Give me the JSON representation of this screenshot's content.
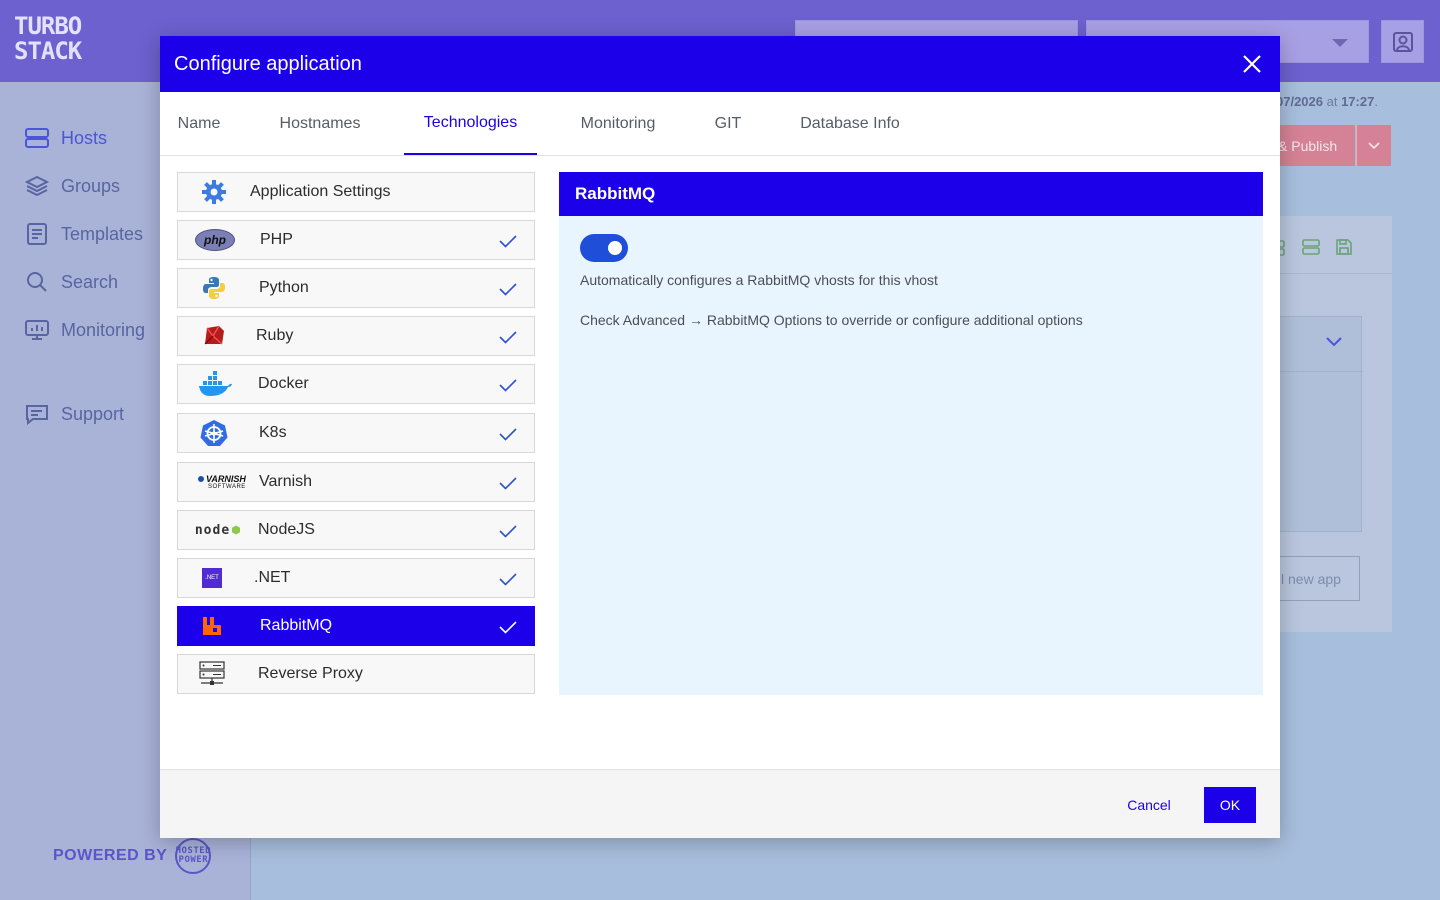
{
  "app": {
    "logo_text": "TURBO STACK",
    "powered_by": "POWERED BY",
    "powered_logo_text": "HOSTED POWER"
  },
  "sidebar": {
    "items": [
      {
        "label": "Hosts",
        "icon": "hosts-icon",
        "active": true
      },
      {
        "label": "Groups",
        "icon": "groups-icon"
      },
      {
        "label": "Templates",
        "icon": "templates-icon"
      },
      {
        "label": "Search",
        "icon": "search-icon"
      },
      {
        "label": "Monitoring",
        "icon": "monitoring-icon"
      },
      {
        "label": "Support",
        "icon": "support-icon"
      }
    ]
  },
  "background": {
    "date_text": "07/2026",
    "date_at": " at ",
    "time_text": "17:27",
    "date_end": ".",
    "publish_label": "& Publish",
    "new_app_label": "l new app"
  },
  "modal": {
    "title": "Configure application",
    "tabs": [
      {
        "label": "Name"
      },
      {
        "label": "Hostnames"
      },
      {
        "label": "Technologies",
        "active": true
      },
      {
        "label": "Monitoring"
      },
      {
        "label": "GIT"
      },
      {
        "label": "Database Info"
      }
    ],
    "technologies": [
      {
        "label": "Application Settings",
        "icon": "gear-icon",
        "checked": false
      },
      {
        "label": "PHP",
        "icon": "php-icon",
        "checked": true
      },
      {
        "label": "Python",
        "icon": "python-icon",
        "checked": true
      },
      {
        "label": "Ruby",
        "icon": "ruby-icon",
        "checked": true
      },
      {
        "label": "Docker",
        "icon": "docker-icon",
        "checked": true
      },
      {
        "label": "K8s",
        "icon": "kubernetes-icon",
        "checked": true
      },
      {
        "label": "Varnish",
        "icon": "varnish-icon",
        "checked": true
      },
      {
        "label": "NodeJS",
        "icon": "nodejs-icon",
        "checked": true
      },
      {
        "label": ".NET",
        "icon": "dotnet-icon",
        "checked": true
      },
      {
        "label": "RabbitMQ",
        "icon": "rabbitmq-icon",
        "checked": true,
        "active": true
      },
      {
        "label": "Reverse Proxy",
        "icon": "server-icon",
        "checked": false
      }
    ],
    "icon_texts": {
      "php": "php",
      "varnish_main": "VARNISH",
      "varnish_sub": "SOFTWARE",
      "node": "node",
      "dotnet": ".NET"
    },
    "detail": {
      "title": "RabbitMQ",
      "toggle_on": true,
      "description": "Automatically configures a RabbitMQ vhosts for this vhost",
      "hint": "Check Advanced → RabbitMQ Options to override or configure additional options"
    },
    "footer": {
      "cancel_label": "Cancel",
      "ok_label": "OK"
    }
  },
  "colors": {
    "primary": "#1c00ea",
    "topbar": "#6c61cf",
    "detail_bg": "#e8f4fe",
    "toggle": "#1f4fd8"
  }
}
